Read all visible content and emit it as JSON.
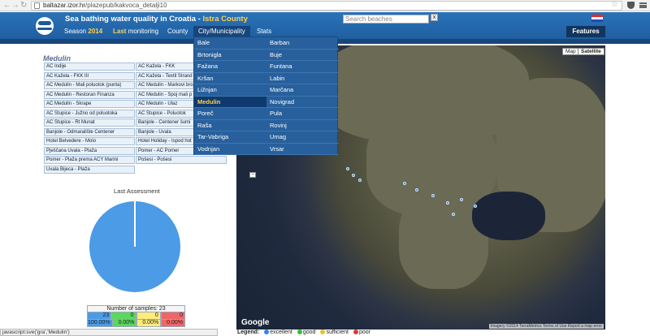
{
  "browser": {
    "url_host": "baltazar.izor.hr",
    "url_path": "/plazepub/kakvoca_detalji10"
  },
  "header": {
    "title": "Sea bathing water quality in Croatia - ",
    "county": "Istra County",
    "search_placeholder": "Search beaches",
    "search_button": "x",
    "features": "Features"
  },
  "nav": {
    "season": "Season",
    "season_year": "2014",
    "last": "Last",
    "monitoring": "monitoring",
    "county": "County",
    "city": "City/Municipality",
    "stats": "Stats"
  },
  "section_title": "Medulin",
  "beaches_left": [
    "AC Indije",
    "AC Kažela - FKK III",
    "AC Medulin - Mali poluotok (punta)",
    "AC Medulin - Restoran Finanza",
    "AC Medulin - Škrape",
    "AC Stupice - Južno od poluotoka",
    "AC Stupice - Rt Munat",
    "Banjole - Odmaralište Centener",
    "Hotel Belvedere - Molo",
    "Pješčana Uvala - Plaža",
    "Pomer - Plaža prema ACY Marini",
    "Uvala Bijeca - Plaža"
  ],
  "beaches_right": [
    "AC Kažela - FKK",
    "AC Kažela - Textil Strand",
    "AC Medulin - Markovi broj",
    "AC Medulin - Spoj mali p",
    "AC Medulin - Ulaz",
    "AC Stupice - Poluotok",
    "Banjole - Centener šumi",
    "Banjole - Uvala",
    "Hotel Holiday - Ispod hot",
    "Pomer - AC Pomer",
    "Pošesi - Pošesi"
  ],
  "assessment": {
    "title": "Last Assessment",
    "samples_label": "Number of samples: 23",
    "counts": [
      "23",
      "0",
      "0",
      "0"
    ],
    "percents": [
      "100.00%",
      "0.00%",
      "0.00%",
      "0.00%"
    ],
    "colors": [
      "#4b9be6",
      "#5cd65c",
      "#ffeb7a",
      "#f06666"
    ]
  },
  "chart_data": {
    "type": "pie",
    "values": [
      100,
      0,
      0,
      0
    ],
    "categories": [
      "excellent",
      "good",
      "sufficient",
      "poor"
    ]
  },
  "map": {
    "map_btn": "Map",
    "sat_btn": "Satellite",
    "google": "Google",
    "attribution": "Imagery ©2014 TerraMetrics  Terms of Use  Report a map error",
    "zoom_out": "−"
  },
  "legend": {
    "label": "Legend:",
    "items": [
      "excellent",
      "good",
      "sufficient",
      "poor"
    ],
    "colors": [
      "#2f86e8",
      "#3cba3c",
      "#e0c43a",
      "#d43a3a"
    ]
  },
  "status_text": "javascript:sve('gra','Medulin')",
  "dropdown": {
    "left": [
      "Bale",
      "Brtonigla",
      "Fažana",
      "Kršan",
      "Ližnjan",
      "Medulin",
      "Poreč",
      "Raša",
      "Tar-Vabriga",
      "Vodnjan"
    ],
    "right": [
      "Barban",
      "Buje",
      "Funtana",
      "Labin",
      "Marčana",
      "Novigrad",
      "Pula",
      "Rovinj",
      "Umag",
      "Vrsar"
    ],
    "active": "Medulin"
  }
}
